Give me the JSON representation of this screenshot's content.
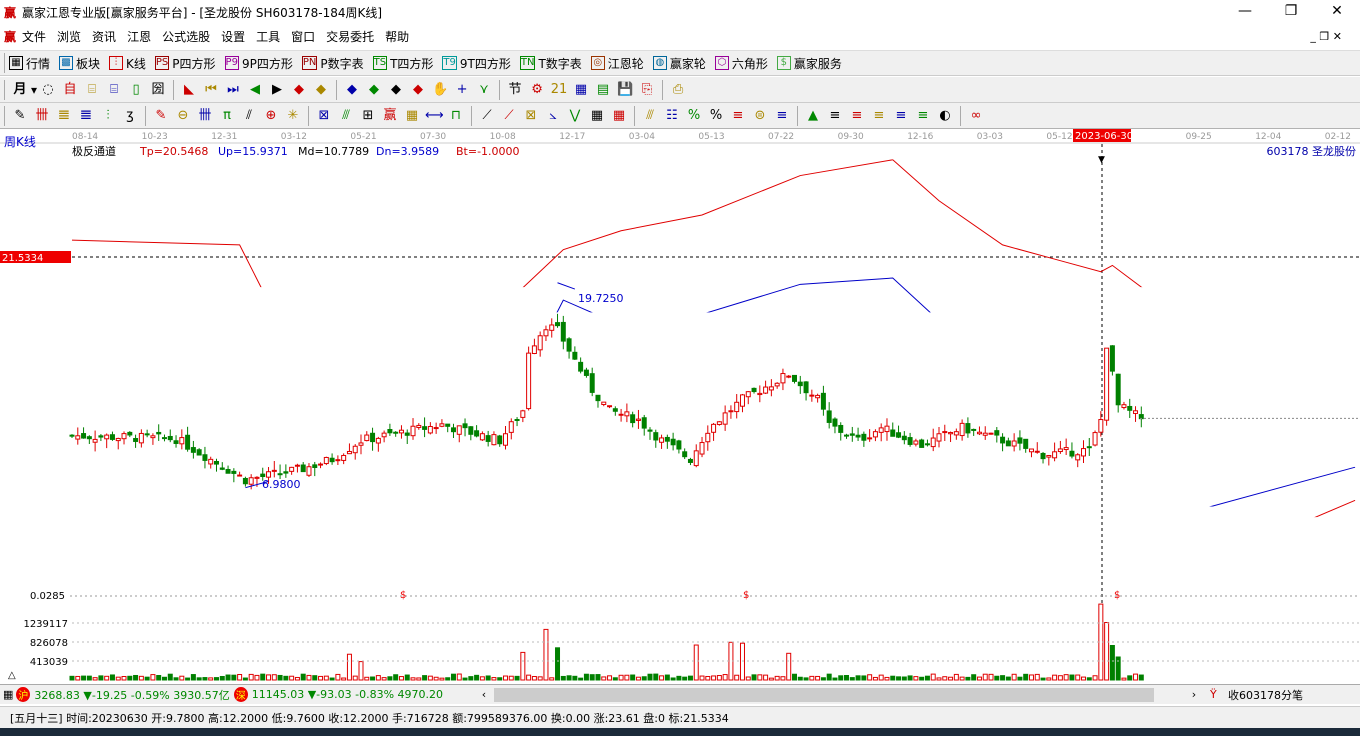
{
  "window": {
    "title": "赢家江恩专业版[赢家服务平台] - [圣龙股份  SH603178-184周K线]",
    "logo": "赢",
    "minimize": "—",
    "restore": "❐",
    "close": "✕"
  },
  "menu": {
    "logo": "赢",
    "items": [
      "文件",
      "浏览",
      "资讯",
      "江恩",
      "公式选股",
      "设置",
      "工具",
      "窗口",
      "交易委托",
      "帮助"
    ]
  },
  "toolbar1": [
    {
      "icon": "▦",
      "label": "行情"
    },
    {
      "icon": "▩",
      "label": "板块"
    },
    {
      "icon": "⫶",
      "label": "K线"
    },
    {
      "icon": "PS",
      "label": "P四方形"
    },
    {
      "icon": "P9",
      "label": "9P四方形"
    },
    {
      "icon": "PN",
      "label": "P数字表"
    },
    {
      "icon": "TS",
      "label": "T四方形"
    },
    {
      "icon": "T9",
      "label": "9T四方形"
    },
    {
      "icon": "TN",
      "label": "T数字表"
    },
    {
      "icon": "◎",
      "label": "江恩轮"
    },
    {
      "icon": "◍",
      "label": "赢家轮"
    },
    {
      "icon": "⬡",
      "label": "六角形"
    },
    {
      "icon": "$",
      "label": "赢家服务"
    }
  ],
  "toolbar2": {
    "period": "月",
    "icons": [
      "◌",
      "自",
      "⌸",
      "⌸",
      "▯",
      "圀",
      "◣",
      "⏮",
      "⏭",
      "◀",
      "▶",
      "◆",
      "◆",
      "◆",
      "◆",
      "◆",
      "◆",
      "✋",
      "+",
      "⋎",
      "节",
      "⚙",
      "21",
      "▦",
      "▤",
      "💾",
      "⎘",
      "⎙"
    ]
  },
  "toolbar3": {
    "icons": [
      "✎",
      "卌",
      "𝌆",
      "𝌆",
      "⫶",
      "ʒ",
      "✎",
      "⊖",
      "卌",
      "π",
      "⫽",
      "⊕",
      "✳",
      "⊠",
      "⫻",
      "⊞",
      "赢",
      "▦",
      "⟷",
      "⊓",
      "⟋",
      "⟋",
      "⊠",
      "⦣",
      "⋁",
      "▦",
      "▦",
      "⫻",
      "☷",
      "%",
      "%",
      "≡",
      "⊜",
      "≡",
      "▲",
      "≡",
      "≡",
      "≡",
      "≡",
      "≡",
      "◐",
      "∞"
    ]
  },
  "chart": {
    "period_label": "周K线",
    "indicator": "极反通道",
    "tp": "Tp=20.5468",
    "up": "Up=15.9371",
    "md": "Md=10.7789",
    "dn": "Dn=3.9589",
    "bt": "Bt=-1.0000",
    "stock": "603178  圣龙股份",
    "cursor_date": "2023-06-30",
    "cursor_price": "21.5334",
    "bottom_price": "0.0285",
    "high_label": "19.7250",
    "low_label": "6.9800",
    "dividend_mark": "$",
    "date_ticks": [
      "08-14",
      "10-23",
      "12-31",
      "03-12",
      "05-21",
      "07-30",
      "10-08",
      "12-17",
      "03-04",
      "05-13",
      "07-22",
      "09-30",
      "12-16",
      "03-03",
      "05-12",
      "",
      "09-25",
      "12-04",
      "02-12"
    ],
    "vol_ticks": [
      "1239117",
      "826078",
      "413039"
    ],
    "colors": {
      "up": "#e00000",
      "down": "#008000",
      "upper": "#e00000",
      "mid": "#000000",
      "band": "#0000c8"
    }
  },
  "chart_data": {
    "type": "candlestick",
    "title": "SH603178 圣龙股份 周K线",
    "price_range": [
      0.0285,
      21.5334
    ],
    "close_keypoints": [
      [
        0,
        10.2
      ],
      [
        18,
        10.0
      ],
      [
        30,
        7.4
      ],
      [
        40,
        8.1
      ],
      [
        45,
        8.7
      ],
      [
        50,
        9.9
      ],
      [
        64,
        10.9
      ],
      [
        74,
        9.9
      ],
      [
        78,
        11.8
      ],
      [
        79,
        15.6
      ],
      [
        82,
        17.2
      ],
      [
        84,
        16.9
      ],
      [
        87,
        15.0
      ],
      [
        90,
        13.1
      ],
      [
        93,
        11.8
      ],
      [
        98,
        11.2
      ],
      [
        102,
        9.9
      ],
      [
        107,
        8.7
      ],
      [
        110,
        10.6
      ],
      [
        116,
        12.5
      ],
      [
        124,
        14.1
      ],
      [
        129,
        12.5
      ],
      [
        131,
        10.9
      ],
      [
        136,
        9.9
      ],
      [
        140,
        10.7
      ],
      [
        147,
        9.6
      ],
      [
        154,
        10.7
      ],
      [
        161,
        9.9
      ],
      [
        168,
        9.0
      ],
      [
        176,
        9.3
      ],
      [
        178,
        11.2
      ],
      [
        179,
        16.0
      ],
      [
        181,
        12.1
      ],
      [
        185,
        11.3
      ]
    ],
    "upper_red": [
      [
        0,
        22.6
      ],
      [
        29,
        22.3
      ],
      [
        33,
        19.4
      ],
      [
        43,
        18.8
      ],
      [
        74,
        18.2
      ],
      [
        85,
        22.0
      ],
      [
        95,
        23.2
      ],
      [
        109,
        24.2
      ],
      [
        126,
        26.7
      ],
      [
        142,
        27.7
      ],
      [
        150,
        25.1
      ],
      [
        161,
        22.3
      ],
      [
        171,
        21.3
      ],
      [
        178,
        20.6
      ],
      [
        180,
        21.0
      ],
      [
        188,
        18.8
      ],
      [
        199,
        16.0
      ],
      [
        213,
        14.9
      ],
      [
        222,
        14.2
      ]
    ],
    "upper_blue": [
      [
        0,
        16.4
      ],
      [
        29,
        15.9
      ],
      [
        33,
        14.7
      ],
      [
        43,
        13.7
      ],
      [
        74,
        13.9
      ],
      [
        81,
        15.9
      ],
      [
        85,
        18.8
      ],
      [
        95,
        17.2
      ],
      [
        109,
        17.9
      ],
      [
        126,
        19.8
      ],
      [
        142,
        20.2
      ],
      [
        150,
        17.5
      ],
      [
        161,
        16.6
      ],
      [
        178,
        15.9
      ],
      [
        185,
        15.6
      ],
      [
        195,
        13.6
      ],
      [
        206,
        12.9
      ],
      [
        222,
        12.6
      ]
    ],
    "middle": [
      [
        0,
        9.5
      ],
      [
        22,
        9.4
      ],
      [
        31,
        8.7
      ],
      [
        50,
        8.8
      ],
      [
        74,
        9.2
      ],
      [
        81,
        9.9
      ],
      [
        95,
        10.7
      ],
      [
        109,
        11.1
      ],
      [
        130,
        11.9
      ],
      [
        143,
        11.8
      ],
      [
        154,
        11.1
      ],
      [
        169,
        10.7
      ],
      [
        178,
        10.7
      ],
      [
        195,
        10.4
      ],
      [
        222,
        10.7
      ]
    ],
    "lower_blue": [
      [
        0,
        0.28
      ],
      [
        29,
        0.28
      ],
      [
        33,
        1.35
      ],
      [
        43,
        1.7
      ],
      [
        74,
        2.9
      ],
      [
        81,
        2.0
      ],
      [
        95,
        1.8
      ],
      [
        126,
        1.2
      ],
      [
        138,
        0.9
      ],
      [
        145,
        1.35
      ],
      [
        154,
        2.9
      ],
      [
        178,
        3.6
      ],
      [
        195,
        5.5
      ],
      [
        222,
        8.2
      ]
    ],
    "lower_red": [
      [
        190,
        -0.4
      ],
      [
        195,
        1.35
      ],
      [
        206,
        3.6
      ],
      [
        222,
        6.1
      ]
    ],
    "volume_spikes": [
      [
        48,
        560000
      ],
      [
        50,
        400000
      ],
      [
        78,
        600000
      ],
      [
        82,
        1100000
      ],
      [
        84,
        700000
      ],
      [
        108,
        760000
      ],
      [
        114,
        820000
      ],
      [
        116,
        800000
      ],
      [
        124,
        580000
      ],
      [
        178,
        1650000
      ],
      [
        179,
        1250000
      ],
      [
        180,
        750000
      ],
      [
        181,
        500000
      ]
    ]
  },
  "status1": {
    "sh_icon": "沪",
    "sh": "3268.83 ▼-19.25 -0.59% 3930.57亿",
    "sz_icon": "深",
    "sz": "11145.03 ▼-93.03 -0.83% 4970.20",
    "left": "‹",
    "right": "›",
    "right_label": "收603178分笔"
  },
  "status2": {
    "text": "[五月十三] 时间:20230630 开:9.7800 高:12.2000 低:9.7600 收:12.2000 手:716728 额:799589376.00 换:0.00 涨:23.61 盘:0 标:21.5334"
  }
}
